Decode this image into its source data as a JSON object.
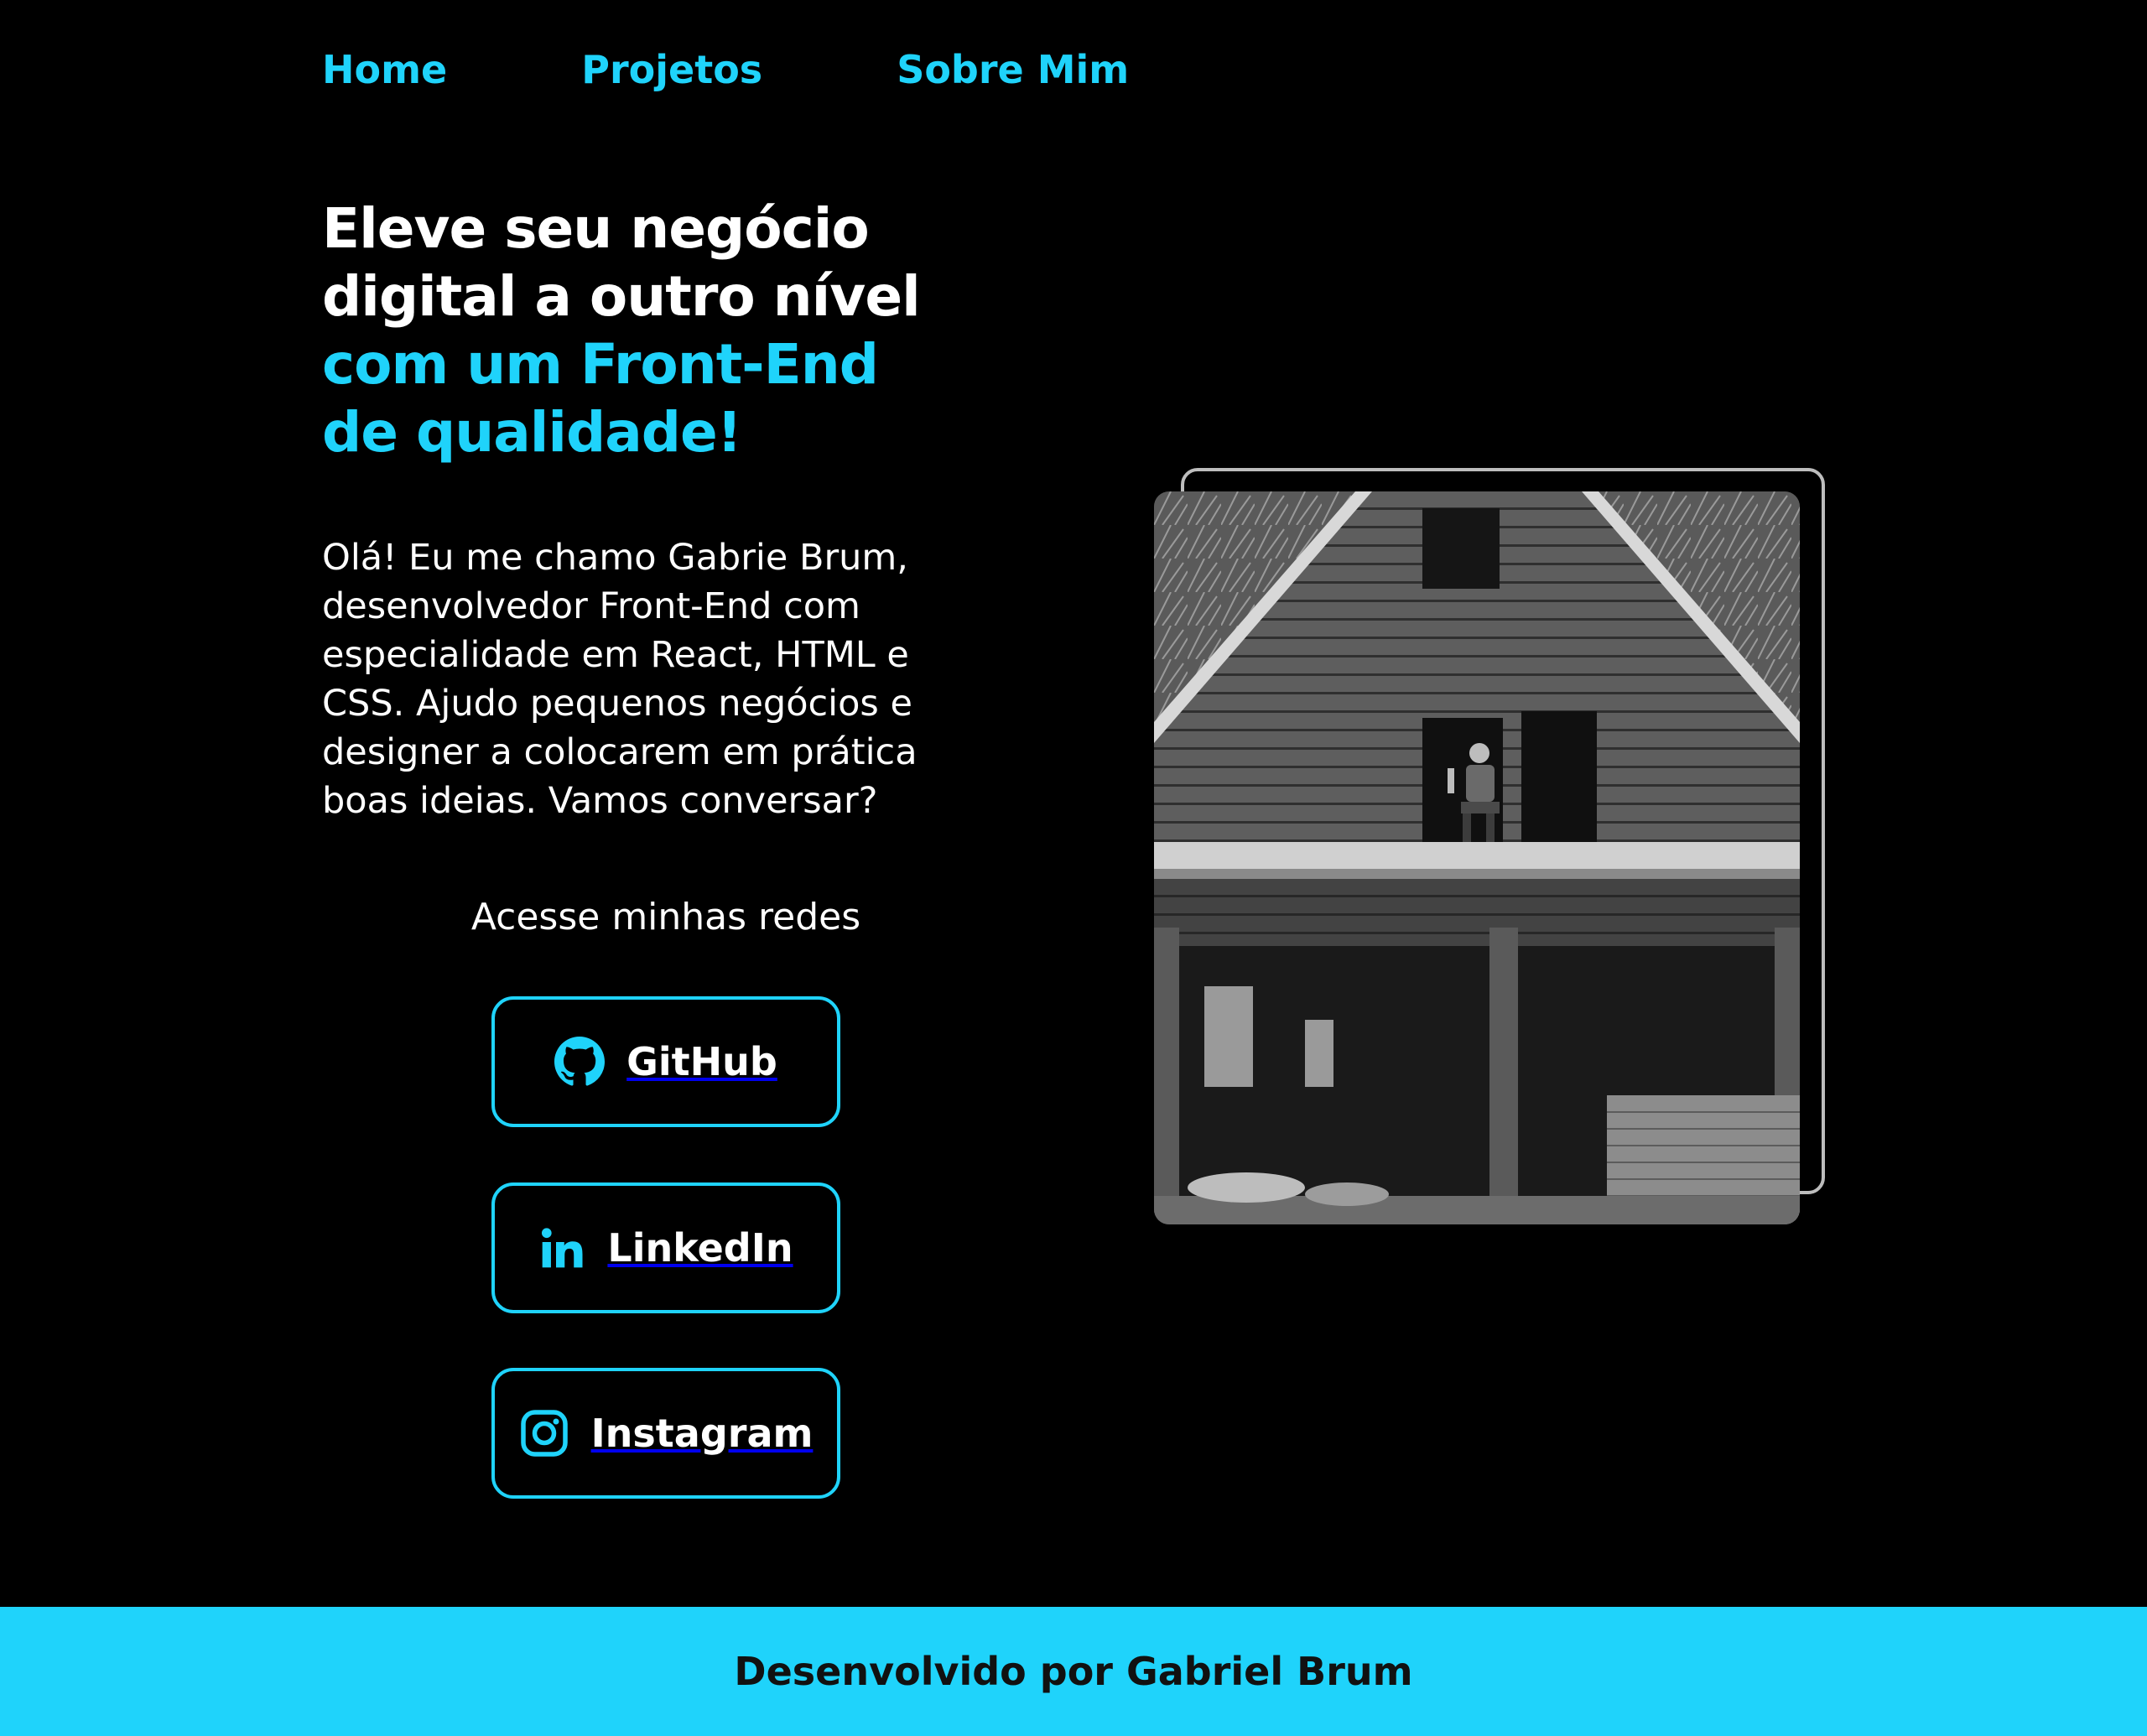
{
  "nav": {
    "items": [
      {
        "label": "Home"
      },
      {
        "label": "Projetos"
      },
      {
        "label": "Sobre Mim"
      }
    ]
  },
  "hero": {
    "headline_lines": [
      {
        "text": "Eleve seu negócio",
        "color": "white"
      },
      {
        "text": "digital a outro nível",
        "color": "white"
      },
      {
        "text": "com um Front-End",
        "color": "cyan"
      },
      {
        "text": "de qualidade!",
        "color": "cyan"
      }
    ],
    "intro_lines": [
      "Olá! Eu me chamo Gabrie Brum,",
      "desenvolvedor Front-End com",
      "especialidade em React, HTML e",
      "CSS. Ajudo pequenos negócios e",
      "designer a colocarem em prática",
      "boas ideias. Vamos conversar?"
    ]
  },
  "social": {
    "title": "Acesse minhas redes",
    "buttons": [
      {
        "label": "GitHub",
        "icon": "github-icon"
      },
      {
        "label": "LinkedIn",
        "icon": "linkedin-icon"
      },
      {
        "label": "Instagram",
        "icon": "instagram-icon"
      }
    ]
  },
  "photo": {
    "description_icon": "profile-photo-wooden-house"
  },
  "footer": {
    "text": "Desenvolvido por Gabriel Brum"
  },
  "colors": {
    "accent": "#1fd3fb",
    "background": "#000000",
    "text": "#ffffff",
    "frame_border": "#bdbdbd",
    "footer_text": "#111111"
  }
}
